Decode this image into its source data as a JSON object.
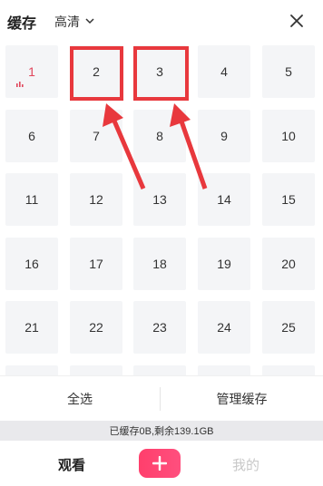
{
  "header": {
    "title": "缓存",
    "quality": "高清",
    "quality_icon": "chevron-down-icon",
    "close_icon": "close-icon"
  },
  "episodes": [
    "1",
    "2",
    "3",
    "4",
    "5",
    "6",
    "7",
    "8",
    "9",
    "10",
    "11",
    "12",
    "13",
    "14",
    "15",
    "16",
    "17",
    "18",
    "19",
    "20",
    "21",
    "22",
    "23",
    "24",
    "25"
  ],
  "playing_episode": "1",
  "highlighted_episodes": [
    "2",
    "3"
  ],
  "colors": {
    "accent": "#e0455b",
    "annotation": "#e8383d",
    "plus_button": "#ff4575",
    "cell_bg": "#f4f5f7"
  },
  "actions": {
    "select_all": "全选",
    "manage_cache": "管理缓存"
  },
  "storage": {
    "text": "已缓存0B,剩余139.1GB"
  },
  "bottom_nav": {
    "watch": "观看",
    "add_icon": "plus-icon",
    "mine": "我的"
  }
}
